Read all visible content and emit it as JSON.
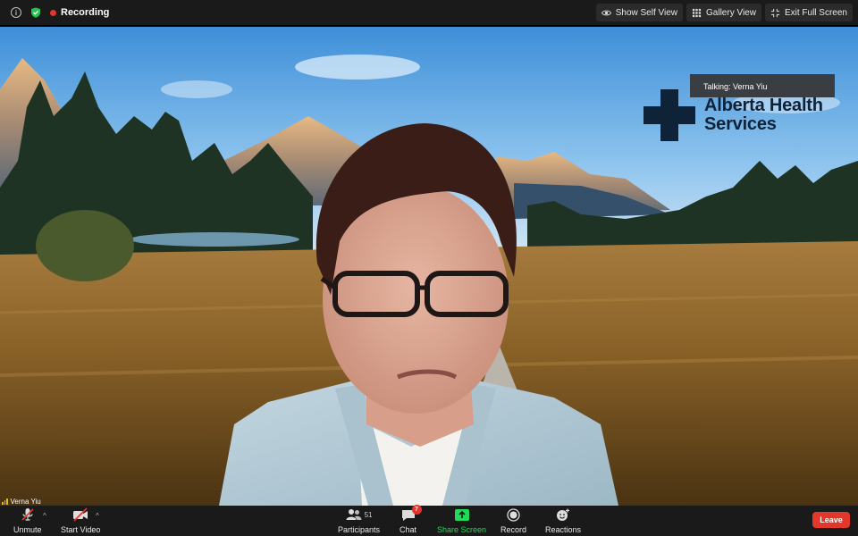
{
  "top_bar": {
    "recording_label": "Recording",
    "buttons": [
      {
        "label": "Show Self View",
        "icon": "eye-icon"
      },
      {
        "label": "Gallery View",
        "icon": "grid-icon"
      },
      {
        "label": "Exit Full Screen",
        "icon": "exit-fullscreen-icon"
      }
    ]
  },
  "video": {
    "talking_label": "Talking: Verna Yiu",
    "participant_name": "Verna Yiu",
    "logo": {
      "line1": "Alberta Health",
      "line2": "Services"
    }
  },
  "toolbar": {
    "unmute": "Unmute",
    "start_video": "Start Video",
    "participants": "Participants",
    "participants_count": "51",
    "chat": "Chat",
    "chat_badge": "7",
    "share_screen": "Share Screen",
    "record": "Record",
    "reactions": "Reactions",
    "leave": "Leave"
  },
  "colors": {
    "toolbar_bg": "#1a1a1a",
    "recording_red": "#e8332a",
    "share_green": "#23d959",
    "leave_red": "#e2372b"
  }
}
